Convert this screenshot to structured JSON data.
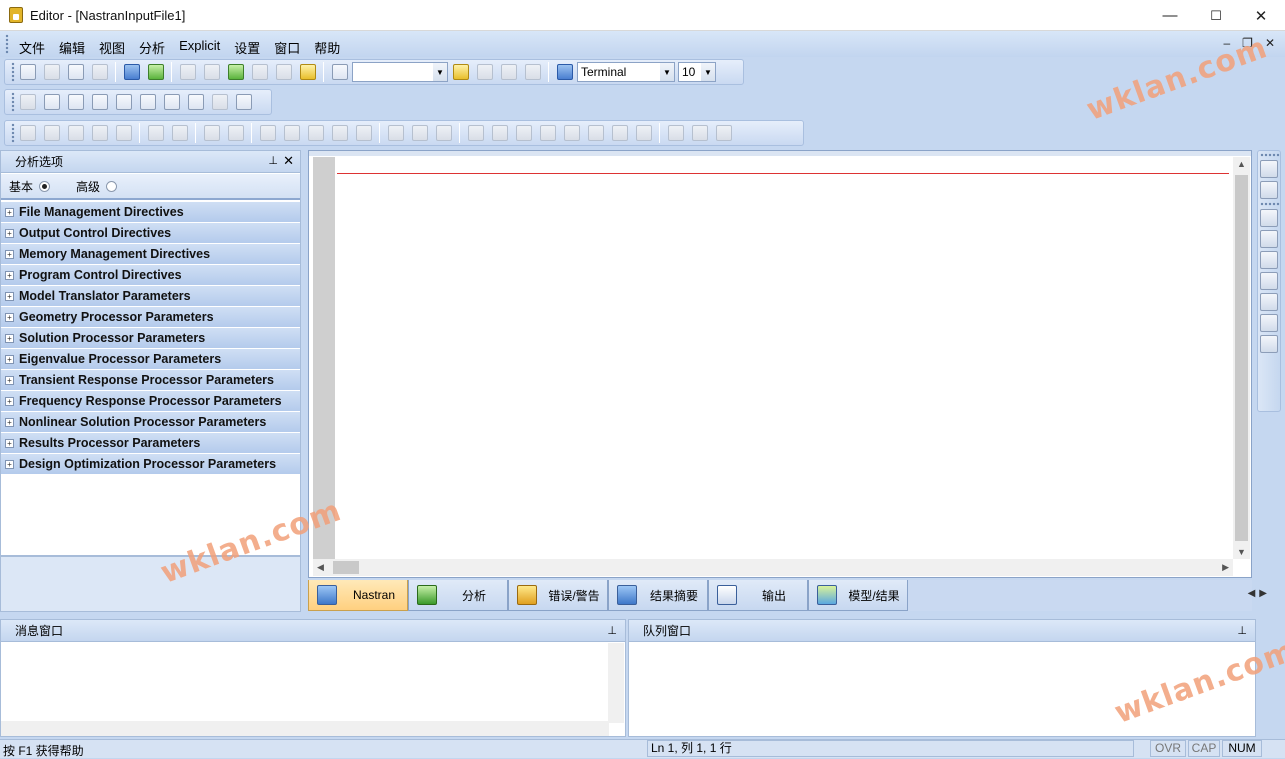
{
  "window": {
    "title": "Editor - [NastranInputFile1]",
    "min": "—",
    "max": "☐",
    "close": "✕"
  },
  "menu": [
    "文件",
    "编辑",
    "视图",
    "分析",
    "Explicit",
    "设置",
    "窗口",
    "帮助"
  ],
  "mdi_controls": {
    "min": "–",
    "restore": "❐",
    "close": "✕"
  },
  "toolbar1": {
    "font_name": "Terminal",
    "font_size": "10",
    "find_value": ""
  },
  "left_panel": {
    "title": "分析选项",
    "pin": "📌",
    "close": "✕",
    "mode_basic": "基本",
    "mode_advanced": "高级",
    "selected_mode": "基本",
    "directives": [
      "File Management Directives",
      "Output Control Directives",
      "Memory Management Directives",
      "Program Control Directives",
      "Model Translator Parameters",
      "Geometry Processor Parameters",
      "Solution Processor Parameters",
      "Eigenvalue Processor Parameters",
      "Transient Response Processor Parameters",
      "Frequency Response Processor Parameters",
      "Nonlinear Solution Processor Parameters",
      "Results Processor Parameters",
      "Design Optimization Processor Parameters"
    ]
  },
  "tabs": [
    "Nastran",
    "分析",
    "错误/警告",
    "结果摘要",
    "输出",
    "模型/结果"
  ],
  "active_tab": "Nastran",
  "message_panel": {
    "title": "消息窗口"
  },
  "queue_panel": {
    "title": "队列窗口"
  },
  "status": {
    "help": "按 F1 获得帮助",
    "position": "Ln 1, 列 1, 1 行",
    "ovr": "OVR",
    "cap": "CAP",
    "num": "NUM"
  },
  "watermark": "wklan.com",
  "colors": {
    "accent": "#c4d6ef",
    "active_tab": "#ffd080",
    "cursor_line": "#dd3333"
  }
}
